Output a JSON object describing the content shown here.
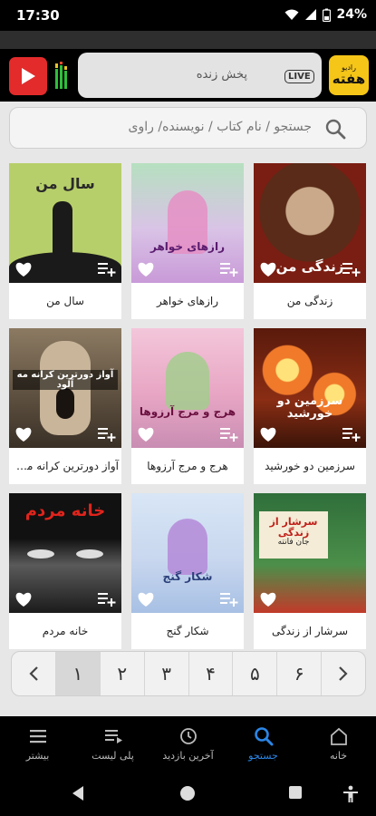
{
  "status": {
    "time": "17:30",
    "battery": "24%"
  },
  "header": {
    "live_label": "LIVE",
    "live_text": "پخش زنده",
    "logo_small": "رادیو",
    "logo_big": "هفته"
  },
  "search": {
    "placeholder": "جستجو / نام کتاب / نویسنده/ راوی"
  },
  "books": [
    {
      "title": "زندگی من",
      "cover_text": "زندگی من",
      "cover_bg": "#7a1d12"
    },
    {
      "title": "رازهای خواهر",
      "cover_text": "رازهای خواهر",
      "cover_bg": "#d9c3e6"
    },
    {
      "title": "سال من",
      "cover_text": "سال من",
      "cover_bg": "#b7cf6a"
    },
    {
      "title": "سرزمین دو خورشید",
      "cover_text": "سرزمین دو خورشید",
      "cover_bg": "#8a2d14"
    },
    {
      "title": "هرج و مرج آرزوها",
      "cover_text": "هرج و مرج آرزوها",
      "cover_bg": "#e8a6c4"
    },
    {
      "title": "آواز دورترین کرانه مه آ...",
      "cover_text": "آواز دورترین کرانه مه آلود",
      "cover_bg": "#3a3026"
    },
    {
      "title": "سرشار از زندگی",
      "cover_text": "سرشار از زندگی",
      "cover_sub": "جان فانته",
      "cover_bg": "#2f6e3a"
    },
    {
      "title": "شکار گنج",
      "cover_text": "شکار گنج",
      "cover_bg": "#c9d7ef"
    },
    {
      "title": "خانه مردم",
      "cover_text": "خانه مردم",
      "cover_bg": "#1b1b1b"
    }
  ],
  "pagination": {
    "prev": "‹",
    "next": "›",
    "pages": [
      "۶",
      "۵",
      "۴",
      "۳",
      "۲",
      "۱"
    ],
    "current": "۱"
  },
  "nav": {
    "items": [
      {
        "label": "خانه",
        "icon": "home-icon"
      },
      {
        "label": "جستجو",
        "icon": "search-icon"
      },
      {
        "label": "آخرین بازدید",
        "icon": "history-icon"
      },
      {
        "label": "پلی لیست",
        "icon": "playlist-icon"
      },
      {
        "label": "بیشتر",
        "icon": "menu-icon"
      }
    ]
  },
  "colors": {
    "accent": "#2b86e6",
    "brand_yellow": "#f5c518",
    "youtube_red": "#e32b2b"
  }
}
